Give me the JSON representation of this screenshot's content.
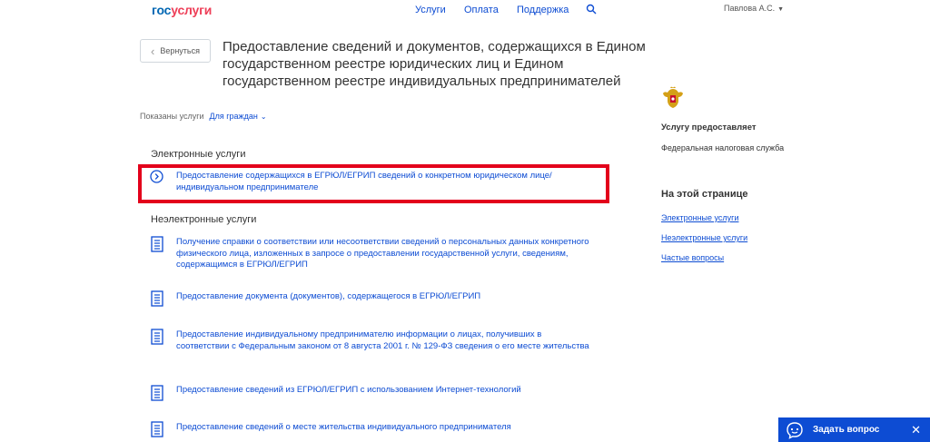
{
  "header": {
    "logo_part1": "гос",
    "logo_part2": "услуги",
    "nav": [
      "Услуги",
      "Оплата",
      "Поддержка"
    ],
    "user_name": "Павлова А.С."
  },
  "back_label": "Вернуться",
  "page_title": "Предоставление сведений и документов, содержащихся в Едином государственном реестре юридических лиц и Едином государственном реестре индивидуальных предпринимателей",
  "filter": {
    "label": "Показаны услуги",
    "value": "Для граждан"
  },
  "electronic": {
    "heading": "Электронные услуги",
    "items": [
      "Предоставление содержащихся в ЕГРЮЛ/ЕГРИП сведений о конкретном юридическом лице/ индивидуальном предпринимателе"
    ]
  },
  "non_electronic": {
    "heading": "Неэлектронные услуги",
    "items": [
      "Получение справки о соответствии или несоответствии сведений о персональных данных конкретного физического лица, изложенных в запросе о предоставлении государственной услуги, сведениям, содержащимся в ЕГРЮЛ/ЕГРИП",
      "Предоставление документа (документов), содержащегося в ЕГРЮЛ/ЕГРИП",
      "Предоставление индивидуальному предпринимателю информации о лицах, получивших в соответствии с Федеральным законом от 8 августа 2001 г. № 129-ФЗ сведения о его месте жительства",
      "Предоставление сведений из ЕГРЮЛ/ЕГРИП с использованием Интернет-технологий",
      "Предоставление сведений о месте жительства индивидуального предпринимателя"
    ]
  },
  "sidebar": {
    "provider_heading": "Услугу предоставляет",
    "provider": "Федеральная налоговая служба",
    "on_page_heading": "На этой странице",
    "links": [
      "Электронные услуги",
      "Неэлектронные услуги",
      "Частые вопросы"
    ]
  },
  "ask_widget": {
    "label": "Задать вопрос"
  }
}
